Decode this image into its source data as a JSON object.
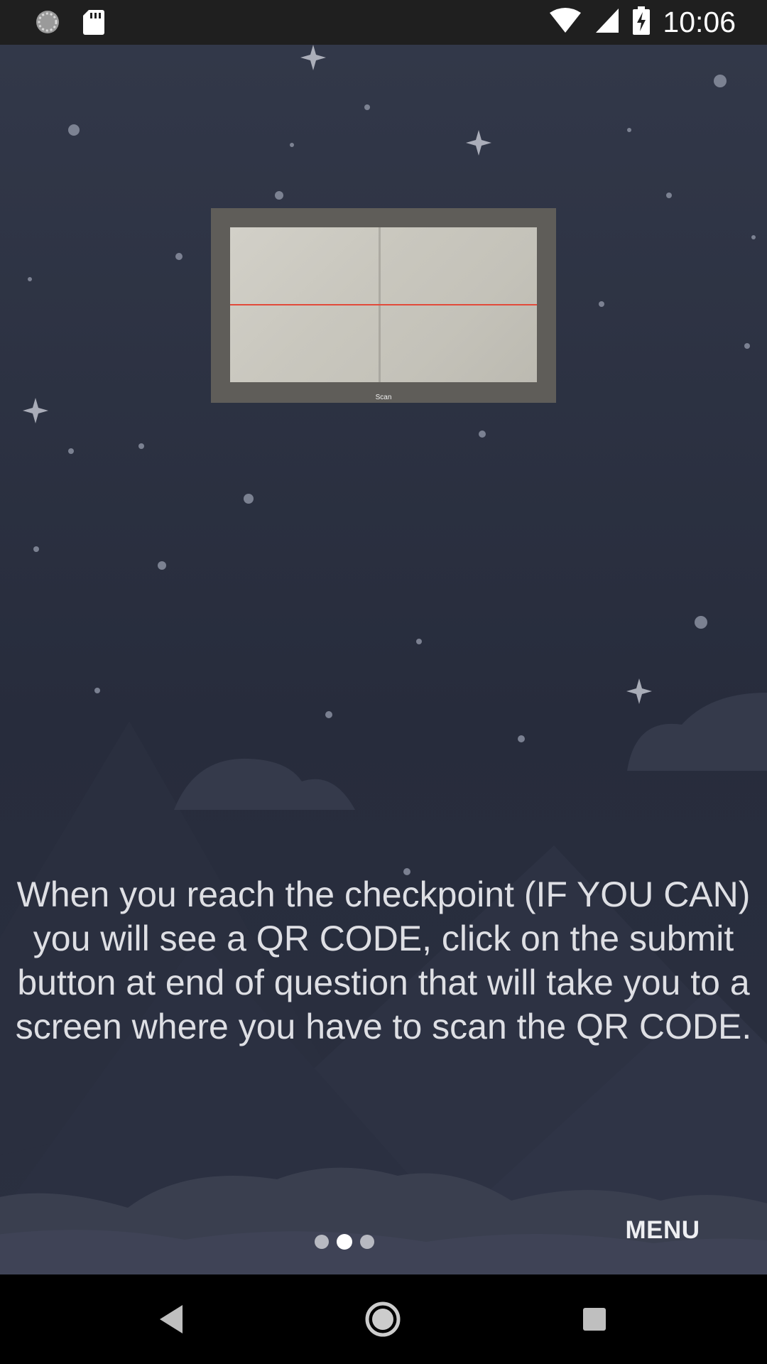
{
  "status_bar": {
    "time": "10:06",
    "icons": [
      "sync-icon",
      "sd-card-icon",
      "wifi-icon",
      "signal-icon",
      "battery-charging-icon"
    ]
  },
  "scan_preview": {
    "label": "Scan"
  },
  "instruction": {
    "text": "When you reach the checkpoint (IF YOU CAN) you will see a QR CODE, click on the submit button at end of question that will take you to a screen where you have to scan the QR CODE."
  },
  "pager": {
    "total": 3,
    "active_index": 1
  },
  "menu_button": {
    "label": "MENU"
  },
  "nav_bar": {
    "icons": [
      "back-icon",
      "home-icon",
      "recents-icon"
    ]
  },
  "colors": {
    "background": "#232838",
    "mountain": "#2a2f3e",
    "cloud": "#3a3f4e",
    "text": "#dedfe4"
  }
}
